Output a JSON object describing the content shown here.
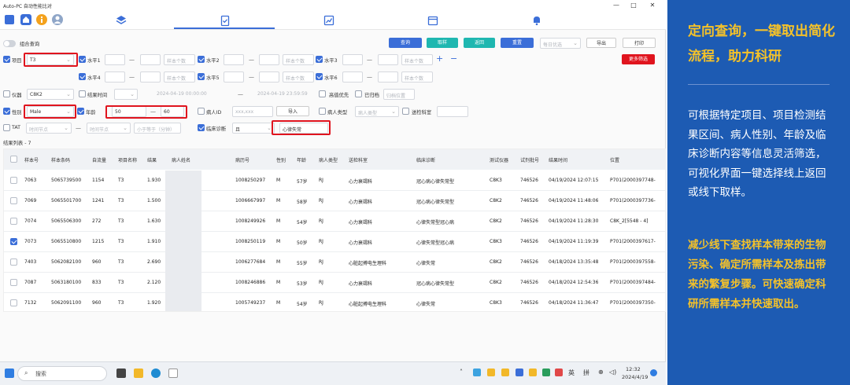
{
  "app": {
    "title": "Auto-PC 自动性能比对",
    "controls": {
      "minimize": "—",
      "maximize": "□",
      "close": "✕"
    }
  },
  "iconbar": {
    "icons": [
      "grid-icon",
      "home-icon",
      "info-icon",
      "user-icon",
      "layers-icon",
      "clipboard-check-icon",
      "chart-icon",
      "calendar-icon",
      "bell-icon"
    ],
    "colors": {
      "accent": "#3b6ed8",
      "highlight": "#e0141e"
    }
  },
  "filters": {
    "combined_query": "组合查询",
    "item": {
      "label": "项目",
      "value": "T3"
    },
    "level1": {
      "label": "水平1",
      "placeholder": "样本个数"
    },
    "level2": {
      "label": "水平2",
      "placeholder": "样本个数"
    },
    "level3": {
      "label": "水平3",
      "placeholder": "样本个数"
    },
    "level4": {
      "label": "水平4",
      "placeholder": "样本个数"
    },
    "level5": {
      "label": "水平5",
      "placeholder": "样本个数"
    },
    "level6": {
      "label": "水平6",
      "placeholder": "样本个数"
    },
    "instrument": {
      "label": "仪器",
      "value": "C8K2"
    },
    "result_time": {
      "label": "结果时间",
      "start": "2024-04-19 00:00:00",
      "end": "2024-04-19 23:59:59"
    },
    "high_value_first": "高值优先",
    "archived": "已归档",
    "archive_position": "归档位置",
    "gender": {
      "label": "性别",
      "value": "Male"
    },
    "age": {
      "label": "年龄",
      "min": "50",
      "max": "60"
    },
    "patient_id": {
      "label": "病人ID",
      "placeholder": "xxx,xxx"
    },
    "import_btn": "导入",
    "patient_type": {
      "label": "病人类型",
      "placeholder": "病人类型"
    },
    "dept": {
      "label": "送检科室"
    },
    "tat": {
      "label": "TAT",
      "from_placeholder": "时间节点",
      "to_placeholder": "时间节点",
      "lt_placeholder": "小于等于（分钟）"
    },
    "diagnosis": {
      "label": "临床诊断",
      "op": "且",
      "value": "心律失常"
    }
  },
  "buttons": {
    "query": "查询",
    "sample": "取样",
    "return": "返回",
    "reset": "重置",
    "preset": "每日优选",
    "export": "导出",
    "print": "打印",
    "more_filter": "更多筛选"
  },
  "result_label": "结果列表 - 7",
  "table": {
    "headers": [
      "样本号",
      "样本条码",
      "自流量",
      "项目名称",
      "结果",
      "病人姓名",
      "病历号",
      "性别",
      "年龄",
      "病人类型",
      "送检科室",
      "临床诊断",
      "测试仪器",
      "试剂批号",
      "结果时间",
      "位置"
    ],
    "rows": [
      {
        "checked": false,
        "cells": [
          "7063",
          "5065739500",
          "1154",
          "T3",
          "1.930",
          "",
          "1008250297",
          "M",
          "57岁",
          "RJ",
          "心力衰竭科",
          "冠心病心律失常型",
          "C8K3",
          "746526",
          "04/19/2024 12:07:15",
          "P701(2000397748-"
        ]
      },
      {
        "checked": false,
        "cells": [
          "7069",
          "5065501700",
          "1241",
          "T3",
          "1.500",
          "",
          "1006667997",
          "M",
          "58岁",
          "RJ",
          "心力衰竭科",
          "冠心病心律失常型",
          "C8K2",
          "746526",
          "04/19/2024 11:48:06",
          "P701(2000397736-"
        ]
      },
      {
        "checked": false,
        "cells": [
          "7074",
          "5065506300",
          "272",
          "T3",
          "1.630",
          "",
          "1008249926",
          "M",
          "54岁",
          "RJ",
          "心力衰竭科",
          "心律失常型冠心病",
          "C8K2",
          "746526",
          "04/19/2024 11:28:30",
          "C8K_2[5548 - 4]"
        ]
      },
      {
        "checked": true,
        "cells": [
          "7073",
          "5065510800",
          "1215",
          "T3",
          "1.910",
          "",
          "1008250119",
          "M",
          "50岁",
          "RJ",
          "心力衰竭科",
          "心律失常型冠心病",
          "C8K3",
          "746526",
          "04/19/2024 11:19:39",
          "P701(2000397617-"
        ]
      },
      {
        "checked": false,
        "cells": [
          "7403",
          "5062082100",
          "960",
          "T3",
          "2.690",
          "",
          "1006277684",
          "M",
          "55岁",
          "RJ",
          "心脏起搏电生理科",
          "心律失常",
          "C8K2",
          "746526",
          "04/18/2024 13:35:48",
          "P701(2000397558-"
        ]
      },
      {
        "checked": false,
        "cells": [
          "7087",
          "5063180100",
          "833",
          "T3",
          "2.120",
          "",
          "1008246886",
          "M",
          "53岁",
          "RJ",
          "心力衰竭科",
          "冠心病心律失常型",
          "C8K2",
          "746526",
          "04/18/2024 12:54:36",
          "P701(2000397484-"
        ]
      },
      {
        "checked": false,
        "cells": [
          "7132",
          "5062091100",
          "960",
          "T3",
          "1.920",
          "",
          "1005749237",
          "M",
          "54岁",
          "RJ",
          "心脏起搏电生理科",
          "心律失常",
          "C8K3",
          "746526",
          "04/18/2024 11:36:47",
          "P701(2000397350-"
        ]
      }
    ]
  },
  "taskbar": {
    "search_placeholder": "搜索",
    "lang1": "英",
    "lang2": "拼",
    "time": "12:32",
    "date": "2024/4/19"
  },
  "panel": {
    "headline": "定向查询，一键取出简化流程，助力科研",
    "desc": "可根据特定项目、项目检测结果区间、病人性别、年龄及临床诊断内容等信息灵活筛选，可视化界面一键选择线上返回或线下取样。",
    "benefit": "减少线下查找样本带来的生物污染、确定所需样本及拣出带来的繁复步骤。可快速确定科研所需样本并快速取出。",
    "colors": {
      "background": "#1d5bb3",
      "highlight": "#f5c229",
      "text": "#ffffff"
    }
  }
}
